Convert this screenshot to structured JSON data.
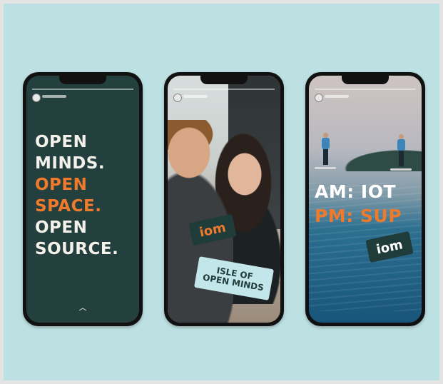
{
  "phones": [
    {
      "lines": [
        {
          "text": "OPEN",
          "color": "#f4f1ea"
        },
        {
          "text": "MINDS.",
          "color": "#f4f1ea"
        },
        {
          "text": "OPEN",
          "color": "#ef7a2c"
        },
        {
          "text": "SPACE.",
          "color": "#ef7a2c"
        },
        {
          "text": "OPEN",
          "color": "#f4f1ea"
        },
        {
          "text": "SOURCE.",
          "color": "#f4f1ea"
        }
      ]
    },
    {
      "logo_sticker": "iom",
      "text_sticker": [
        "ISLE OF",
        "OPEN MINDS"
      ]
    },
    {
      "line1": "AM: IOT",
      "line2": "PM: SUP",
      "logo_sticker": "iom"
    }
  ],
  "colors": {
    "background": "#bde0e2",
    "accent": "#ef7a2c",
    "dark_green": "#233f3e"
  }
}
